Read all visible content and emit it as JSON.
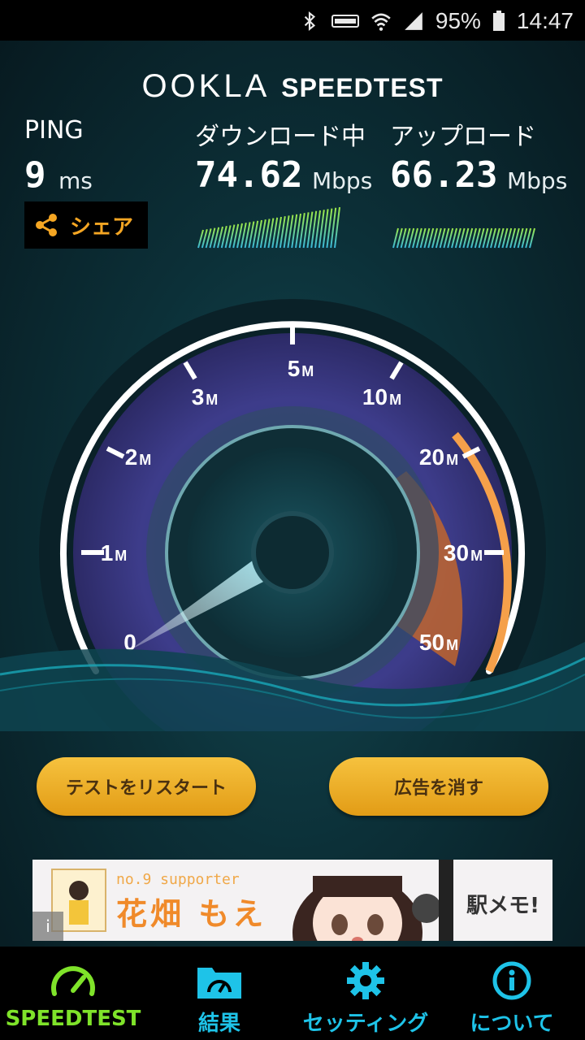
{
  "status_bar": {
    "battery": "95%",
    "time": "14:47",
    "icons": [
      "bluetooth-icon",
      "volte-icon",
      "wifi-icon",
      "signal-icon",
      "battery-icon"
    ]
  },
  "header": {
    "logo_ookla": "OOKLA",
    "logo_speedtest": "SPEEDTEST"
  },
  "metrics": {
    "ping_label": "PING",
    "ping_value": "9",
    "ping_unit": "ms",
    "download_label": "ダウンロード中",
    "download_value": "74.62",
    "download_unit": "Mbps",
    "upload_label": "アップロード",
    "upload_value": "66.23",
    "upload_unit": "Mbps"
  },
  "share_button": {
    "label": "シェア"
  },
  "gauge": {
    "ticks": [
      {
        "n": "0",
        "u": ""
      },
      {
        "n": "1",
        "u": "M"
      },
      {
        "n": "2",
        "u": "M"
      },
      {
        "n": "3",
        "u": "M"
      },
      {
        "n": "5",
        "u": "M"
      },
      {
        "n": "10",
        "u": "M"
      },
      {
        "n": "20",
        "u": "M"
      },
      {
        "n": "30",
        "u": "M"
      },
      {
        "n": "50",
        "u": "M"
      }
    ]
  },
  "buttons": {
    "restart": "テストをリスタート",
    "remove_ads": "広告を消す"
  },
  "ad": {
    "tag": "no.9 supporter",
    "name": "花畑 もえ",
    "brand": "駅メモ!",
    "info": "i"
  },
  "nav": [
    {
      "label": "SPEEDTEST",
      "icon": "speedometer-icon",
      "color": "#7fe32a"
    },
    {
      "label": "結果",
      "icon": "folder-icon",
      "color": "#1ec3e8"
    },
    {
      "label": "セッティング",
      "icon": "gear-icon",
      "color": "#1ec3e8"
    },
    {
      "label": "について",
      "icon": "info-icon",
      "color": "#1ec3e8"
    }
  ],
  "colors": {
    "accent_orange": "#f5a623",
    "gauge_purple": "#a46ff0",
    "nav_active": "#7fe32a",
    "nav_inactive": "#1ec3e8"
  }
}
